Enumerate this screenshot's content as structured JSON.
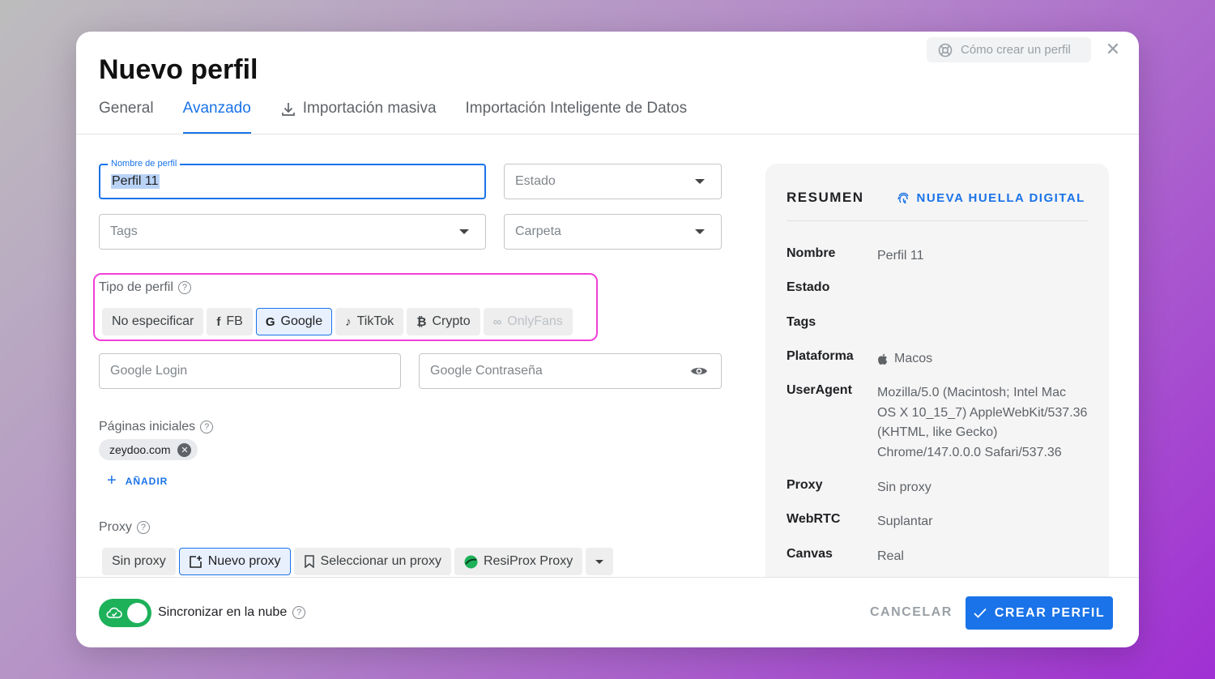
{
  "modal": {
    "title": "Nuevo perfil",
    "help_label": "Cómo crear un perfil",
    "close_symbol": "✕"
  },
  "tabs": [
    {
      "label": "General",
      "active": false
    },
    {
      "label": "Avanzado",
      "active": true
    },
    {
      "label": "Importación masiva",
      "active": false,
      "icon": "download-icon"
    },
    {
      "label": "Importación Inteligente de Datos",
      "active": false
    }
  ],
  "form": {
    "profile_name_label": "Nombre de perfil",
    "profile_name_value": "Perfil 11",
    "estado_placeholder": "Estado",
    "tags_placeholder": "Tags",
    "carpeta_placeholder": "Carpeta",
    "profile_type_label": "Tipo de perfil",
    "profile_types": [
      {
        "label": "No especificar",
        "icon": "",
        "selected": false,
        "disabled": false
      },
      {
        "label": "FB",
        "icon": "facebook-icon",
        "selected": false,
        "disabled": false
      },
      {
        "label": "Google",
        "icon": "google-icon",
        "selected": true,
        "disabled": false
      },
      {
        "label": "TikTok",
        "icon": "tiktok-icon",
        "selected": false,
        "disabled": false
      },
      {
        "label": "Crypto",
        "icon": "bitcoin-icon",
        "selected": false,
        "disabled": false
      },
      {
        "label": "OnlyFans",
        "icon": "onlyfans-icon",
        "selected": false,
        "disabled": true
      }
    ],
    "google_login_placeholder": "Google Login",
    "google_password_placeholder": "Google Contraseña",
    "start_pages_label": "Páginas iniciales",
    "start_pages": [
      "zeydoo.com"
    ],
    "add_label": "AÑADIR",
    "proxy_label": "Proxy",
    "proxy_options": [
      {
        "label": "Sin proxy",
        "icon": "",
        "selected": false
      },
      {
        "label": "Nuevo proxy",
        "icon": "new-proxy-icon",
        "selected": true
      },
      {
        "label": "Seleccionar un proxy",
        "icon": "bookmark-icon",
        "selected": false
      },
      {
        "label": "ResiProx Proxy",
        "icon": "resiprox-logo-icon",
        "selected": false
      }
    ]
  },
  "summary": {
    "title": "RESUMEN",
    "new_fingerprint_label": "NUEVA HUELLA DIGITAL",
    "rows": [
      {
        "key": "Nombre",
        "value": "Perfil 11"
      },
      {
        "key": "Estado",
        "value": ""
      },
      {
        "key": "Tags",
        "value": ""
      },
      {
        "key": "Plataforma",
        "value": "Macos"
      },
      {
        "key": "UserAgent",
        "value": "Mozilla/5.0 (Macintosh; Intel Mac OS X 10_15_7) AppleWebKit/537.36 (KHTML, like Gecko) Chrome/147.0.0.0 Safari/537.36"
      },
      {
        "key": "Proxy",
        "value": "Sin proxy"
      },
      {
        "key": "WebRTC",
        "value": "Suplantar"
      },
      {
        "key": "Canvas",
        "value": "Real"
      }
    ]
  },
  "footer": {
    "sync_label": "Sincronizar en la nube",
    "sync_enabled": true,
    "cancel_label": "CANCELAR",
    "create_label": "CREAR PERFIL"
  },
  "colors": {
    "accent": "#1a73e8",
    "highlight": "#f23fd9",
    "toggle_on": "#1db15a"
  }
}
